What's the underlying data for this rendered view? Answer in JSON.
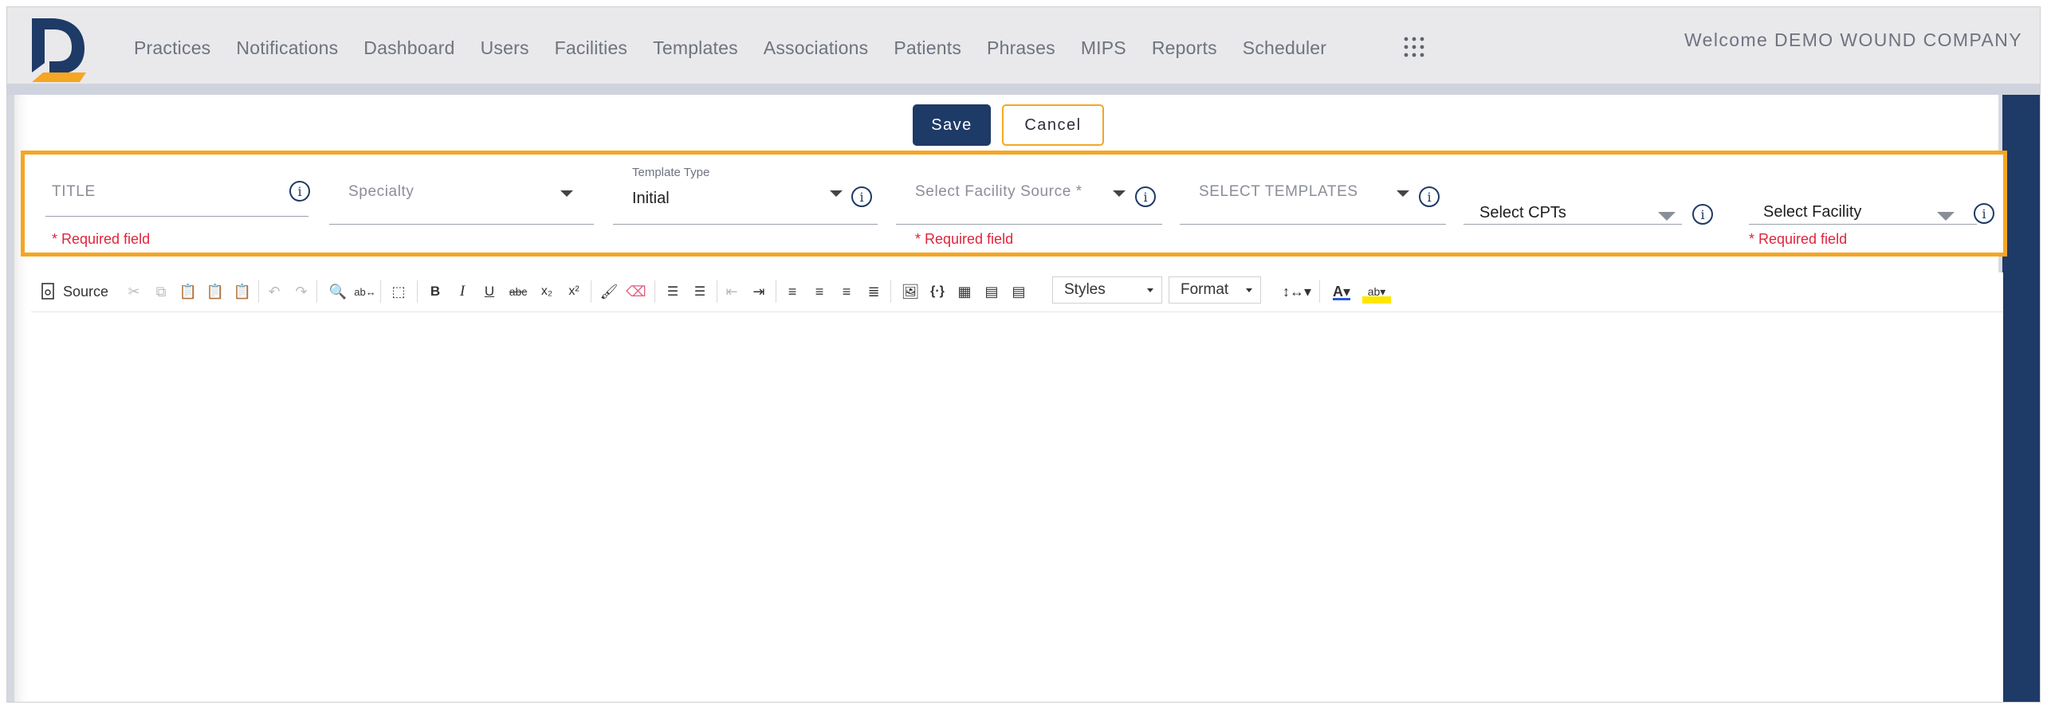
{
  "nav": {
    "items": [
      "Practices",
      "Notifications",
      "Dashboard",
      "Users",
      "Facilities",
      "Templates",
      "Associations",
      "Patients",
      "Phrases",
      "MIPS",
      "Reports",
      "Scheduler"
    ],
    "apps_icon": "apps-grid-icon",
    "welcome": "Welcome DEMO WOUND COMPANY"
  },
  "actions": {
    "save": "Save",
    "cancel": "Cancel"
  },
  "form": {
    "title_placeholder": "TITLE",
    "specialty_placeholder": "Specialty",
    "template_type_label": "Template Type",
    "template_type_value": "Initial",
    "facility_source_placeholder": "Select Facility Source *",
    "templates_placeholder": "SELECT TEMPLATES",
    "cpts_placeholder": "Select CPTs",
    "facility_placeholder": "Select Facility",
    "required_text": "* Required field",
    "info_glyph": "i"
  },
  "toolbar": {
    "source_label": "Source",
    "bold": "B",
    "italic": "I",
    "underline": "U",
    "strike": "abc",
    "subscript": "x₂",
    "superscript": "x²",
    "styles_label": "Styles",
    "format_label": "Format",
    "placeholder_glyph": "{·}",
    "icons": [
      "source-icon",
      "cut-icon",
      "copy-icon",
      "paste-icon",
      "paste-text-icon",
      "paste-word-icon",
      "undo-icon",
      "redo-icon",
      "find-icon",
      "replace-icon",
      "select-all-icon",
      "bold-icon",
      "italic-icon",
      "underline-icon",
      "strikethrough-icon",
      "subscript-icon",
      "superscript-icon",
      "copy-formatting-icon",
      "remove-format-icon",
      "numbered-list-icon",
      "bulleted-list-icon",
      "decrease-indent-icon",
      "increase-indent-icon",
      "align-left-icon",
      "align-center-icon",
      "align-right-icon",
      "justify-icon",
      "image-icon",
      "placeholder-icon",
      "table-icon",
      "templates-icon",
      "page-break-icon",
      "line-height-icon",
      "text-color-icon",
      "background-color-icon"
    ]
  },
  "colors": {
    "brand_navy": "#1e3a67",
    "accent_orange": "#f5a623",
    "required_red": "#e0243b"
  }
}
